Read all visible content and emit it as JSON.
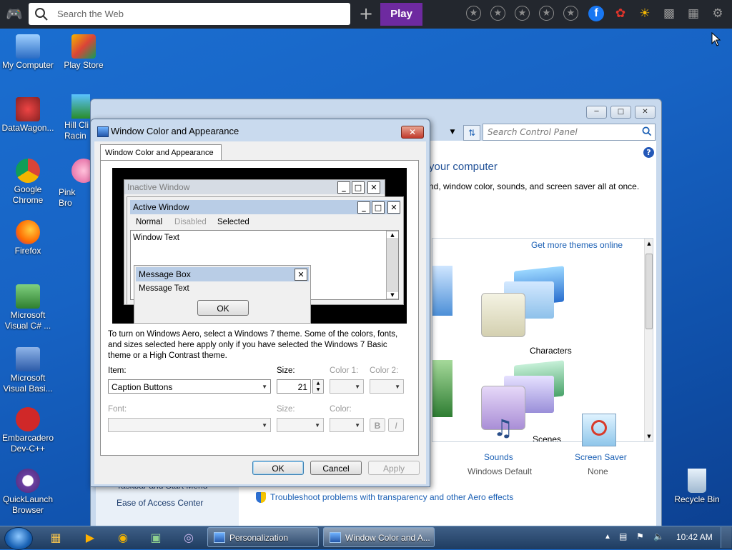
{
  "topbar": {
    "search_placeholder": "Search the Web",
    "play_label": "Play",
    "icons": [
      "gamepad-icon",
      "search-icon",
      "plus-icon",
      "star-icon",
      "star-icon",
      "star-icon",
      "star-icon",
      "star-icon",
      "facebook-icon",
      "bug-icon",
      "weather-icon",
      "folder-icon",
      "trash-icon",
      "gear-icon"
    ]
  },
  "desktop": {
    "icons": [
      {
        "label": "My Computer"
      },
      {
        "label": "Play Store"
      },
      {
        "label": "DataWagon..."
      },
      {
        "label": "Hill Cli Racin"
      },
      {
        "label": "Google Chrome"
      },
      {
        "label": "Pink Bro"
      },
      {
        "label": "Firefox"
      },
      {
        "label": "Microsoft Visual C# ..."
      },
      {
        "label": "Microsoft Visual Basi..."
      },
      {
        "label": "Embarcadero Dev-C++"
      },
      {
        "label": "QuickLaunch Browser"
      },
      {
        "label": "Recycle Bin"
      }
    ]
  },
  "personalization": {
    "search_placeholder": "Search Control Panel",
    "heading_fragment": "your computer",
    "desc_fragment": "nd, window color, sounds, and screen saver all at once.",
    "get_more_themes": "Get more themes online",
    "themes": [
      {
        "label": "Characters"
      },
      {
        "label": "Scenes"
      }
    ],
    "sounds": {
      "label": "Sounds",
      "value": "Windows Default"
    },
    "screensaver": {
      "label": "Screen Saver",
      "value": "None"
    },
    "left_links": [
      "Taskbar and Start Menu",
      "Ease of Access Center"
    ],
    "troubleshoot": "Troubleshoot problems with transparency and other Aero effects"
  },
  "dialog": {
    "title": "Window Color and Appearance",
    "tab": "Window Color and Appearance",
    "preview": {
      "inactive_title": "Inactive Window",
      "active_title": "Active Window",
      "menu_normal": "Normal",
      "menu_disabled": "Disabled",
      "menu_selected": "Selected",
      "window_text": "Window Text",
      "msgbox_title": "Message Box",
      "msgbox_text": "Message Text",
      "msgbox_ok": "OK"
    },
    "info_text": "To turn on Windows Aero, select a Windows 7 theme.  Some of the colors, fonts, and sizes selected here apply only if you have selected the Windows 7 Basic theme or a High Contrast theme.",
    "item_label": "Item:",
    "item_value": "Caption Buttons",
    "size_label": "Size:",
    "size_value": "21",
    "color1_label": "Color 1:",
    "color2_label": "Color 2:",
    "font_label": "Font:",
    "size2_label": "Size:",
    "color_label": "Color:",
    "bold_label": "B",
    "italic_label": "I",
    "ok_label": "OK",
    "cancel_label": "Cancel",
    "apply_label": "Apply"
  },
  "taskbar": {
    "buttons": [
      {
        "label": "Personalization"
      },
      {
        "label": "Window Color and A..."
      }
    ],
    "clock": "10:42 AM"
  }
}
